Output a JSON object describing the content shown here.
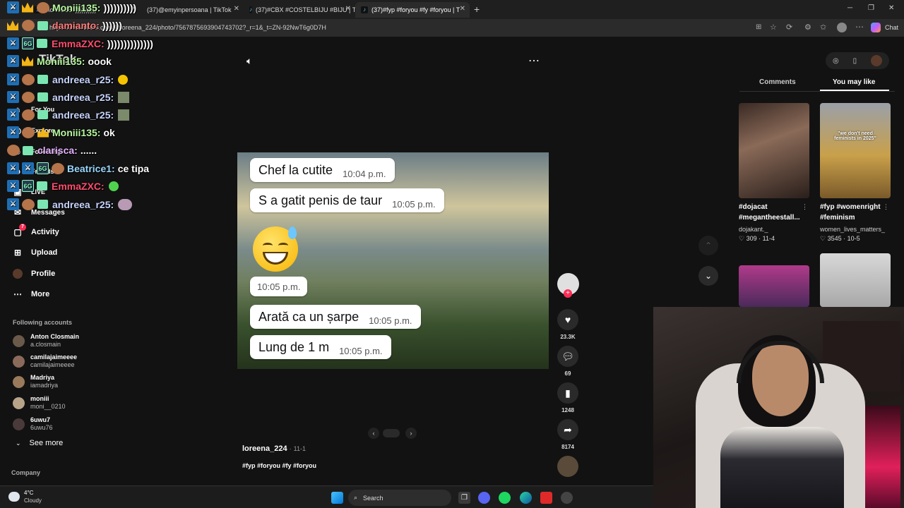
{
  "browser": {
    "tabs": [
      {
        "label": "Moniii135: ))))))))))"
      },
      {
        "label": "(37)@emyinpersoana | TikTok"
      },
      {
        "label": "(37)#CBX #COSTELBIJU #BIJU | Tik"
      },
      {
        "label": "(37)#fyp #foryou #fy #foryou | T"
      }
    ],
    "new_tab": "+",
    "url": "https://www.tiktok.com/@loreena_224/photo/7567875693904743702?_r=1&_t=ZN-92NwT6g0D7H",
    "chat_label": "Chat"
  },
  "chat_overlay": [
    {
      "user": "Moniii135:",
      "msg": "))))))))))",
      "color": "#b7f79e"
    },
    {
      "user": "damianto:",
      "msg": "))))))",
      "color": "#ff7a7a"
    },
    {
      "user": "EmmaZXC:",
      "msg": "))))))))))))))",
      "color": "#ff4d6d"
    },
    {
      "user": "Moniii135:",
      "msg": "oook",
      "color": "#b7f79e"
    },
    {
      "user": "andreea_r25:",
      "msg": "",
      "color": "#c7d5ff"
    },
    {
      "user": "andreea_r25:",
      "msg": "",
      "color": "#c7d5ff"
    },
    {
      "user": "andreea_r25:",
      "msg": "",
      "color": "#c7d5ff"
    },
    {
      "user": "Moniii135:",
      "msg": "ok",
      "color": "#b7f79e"
    },
    {
      "user": "clarisca:",
      "msg": "......",
      "color": "#e7b2ff"
    },
    {
      "user": "Beatrice1:",
      "msg": "ce tipa",
      "color": "#9ad7ff"
    },
    {
      "user": "EmmaZXC:",
      "msg": "",
      "color": "#ff4d6d"
    },
    {
      "user": "andreea_r25:",
      "msg": "",
      "color": "#c7d5ff"
    }
  ],
  "sidebar": {
    "logo": "TikTok",
    "nav": [
      {
        "label": "For You"
      },
      {
        "label": "Explore"
      },
      {
        "label": "Following"
      },
      {
        "label": "Friends"
      },
      {
        "label": "LIVE"
      },
      {
        "label": "Messages"
      },
      {
        "label": "Activity",
        "badge": "7"
      },
      {
        "label": "Upload"
      },
      {
        "label": "Profile"
      },
      {
        "label": "More"
      }
    ],
    "following_title": "Following accounts",
    "accounts": [
      {
        "name": "Anton Closmain",
        "handle": "a.closmain"
      },
      {
        "name": "camilajaimeeee",
        "handle": "camilajaimeeee"
      },
      {
        "name": "Madriya",
        "handle": "iamadriya"
      },
      {
        "name": "moniii",
        "handle": "moni__0210"
      },
      {
        "name": "6uwu7",
        "handle": "6uwu76"
      }
    ],
    "see_more": "See more",
    "company": "Company"
  },
  "post": {
    "messages": [
      {
        "text": "Chef la cutite",
        "time": "10:04 p.m."
      },
      {
        "text": "S a gatit penis de taur",
        "time": "10:05 p.m."
      },
      {
        "text": "",
        "time": "10:05 p.m."
      },
      {
        "text": "Arată ca un șarpe",
        "time": "10:05 p.m."
      },
      {
        "text": "Lung de 1 m",
        "time": "10:05 p.m."
      }
    ],
    "author": "loreena_224",
    "date": "11-1",
    "hashtags": "#fyp #foryou #fy #foryou",
    "likes": "23.3K",
    "comments": "69",
    "saves": "1248",
    "shares": "8174"
  },
  "right_panel": {
    "tabs": [
      "Comments",
      "You may like"
    ],
    "cards": [
      {
        "caption": "#dojacat #megantheestall...",
        "user": "dojakant._",
        "likes": "309",
        "date": "11-4"
      },
      {
        "caption": "#fyp #womenright #feminism",
        "user": "women_lives_matters_",
        "likes": "3545",
        "date": "10-5",
        "overlay": "\"we don't need feminists in 2025\""
      }
    ]
  },
  "taskbar": {
    "weather_temp": "4°C",
    "weather_desc": "Cloudy",
    "search": "Search"
  }
}
